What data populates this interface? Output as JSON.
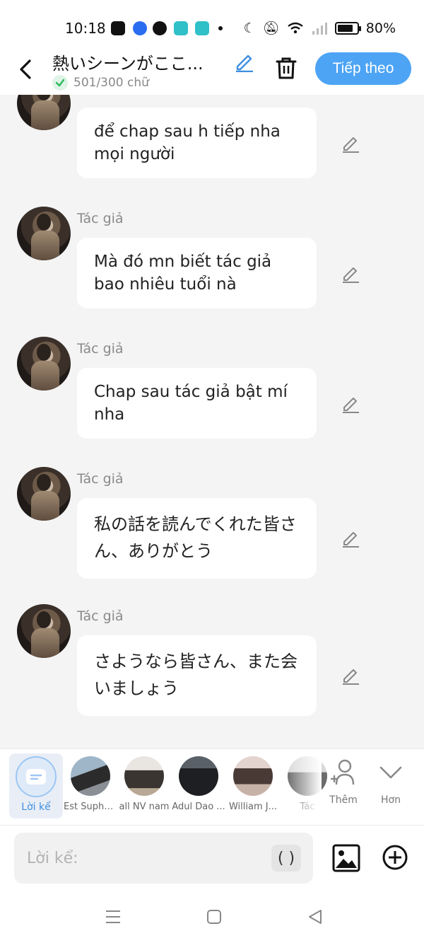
{
  "status": {
    "time": "10:18",
    "battery": "80%",
    "battery_level": 0.8
  },
  "header": {
    "title": "熱いシーンがここ...",
    "word_count": "501/300 chữ",
    "next_label": "Tiếp theo"
  },
  "messages": [
    {
      "author": "",
      "text": "để chap sau h tiếp nha mọi người"
    },
    {
      "author": "Tác giả",
      "text": "Mà đó mn biết tác giả bao nhiêu tuổi nà"
    },
    {
      "author": "Tác giả",
      "text": "Chap sau tác giả bật mí nha"
    },
    {
      "author": "Tác giả",
      "text": "私の話を読んでくれた皆さん、ありがとう"
    },
    {
      "author": "Tác giả",
      "text": "さようなら皆さん、また会いましょう"
    }
  ],
  "characters": [
    {
      "name": "Lời kể",
      "selected": true
    },
    {
      "name": "Est Supha..."
    },
    {
      "name": "all NV nam"
    },
    {
      "name": "Adul Dao ..."
    },
    {
      "name": "William J..."
    },
    {
      "name": "Tác"
    }
  ],
  "actions": {
    "add_label": "Thêm",
    "more_label": "Hơn"
  },
  "input": {
    "placeholder": "Lời kể:",
    "paren_label": "( )"
  }
}
